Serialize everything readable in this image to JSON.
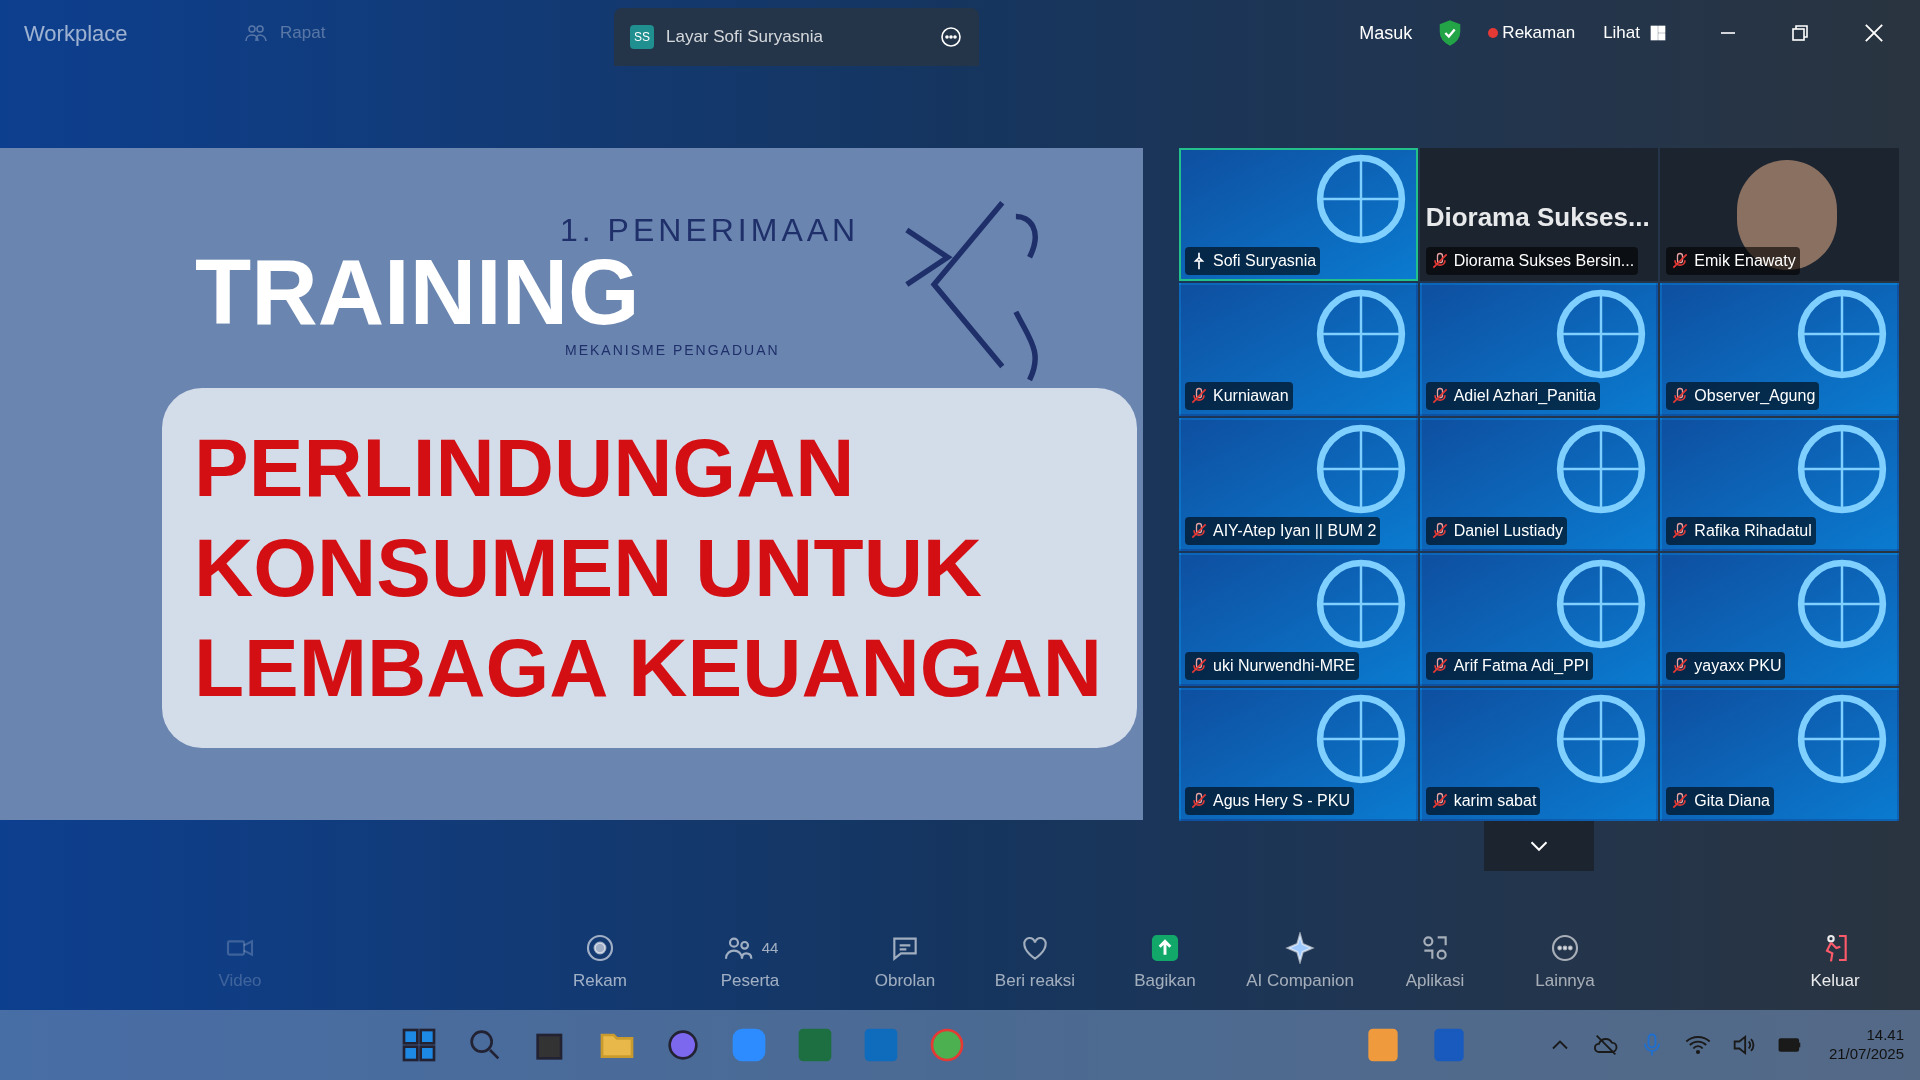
{
  "top_bar": {
    "app": "Workplace",
    "meeting_tab": "Rapat",
    "share_tab": {
      "initials": "SS",
      "label": "Layar Sofi Suryasnia"
    },
    "sign_in": "Masuk",
    "recording": "Rekaman",
    "view": "Lihat"
  },
  "shared_screen": {
    "heading": "1. PENERIMAAN",
    "subheading": "MEKANISME PENGADUAN"
  },
  "overlay": {
    "kicker": "TRAINING",
    "title_lines": [
      "PERLINDUNGAN",
      "KONSUMEN UNTUK",
      "LEMBAGA KEUANGAN"
    ]
  },
  "gallery": [
    {
      "name": "Sofi Suryasnia",
      "kind": "slide",
      "muted": false,
      "active": true
    },
    {
      "name": "Diorama Sukses Bersin...",
      "kind": "name-text",
      "banner": "Diorama  Sukses...",
      "muted": true,
      "active": false
    },
    {
      "name": "Emik Enawaty",
      "kind": "photo",
      "muted": true,
      "active": false
    },
    {
      "name": "Kurniawan",
      "kind": "slide",
      "muted": true,
      "active": false
    },
    {
      "name": "Adiel Azhari_Panitia",
      "kind": "slide",
      "muted": true,
      "active": false
    },
    {
      "name": "Observer_Agung",
      "kind": "slide",
      "muted": true,
      "active": false
    },
    {
      "name": "AIY-Atep Iyan || BUM 2",
      "kind": "slide",
      "muted": true,
      "active": false
    },
    {
      "name": "Daniel Lustiady",
      "kind": "slide",
      "muted": true,
      "active": false
    },
    {
      "name": "Rafika Rihadatul",
      "kind": "slide",
      "muted": true,
      "active": false
    },
    {
      "name": "uki Nurwendhi-MRE",
      "kind": "slide",
      "muted": true,
      "active": false
    },
    {
      "name": "Arif Fatma Adi_PPI",
      "kind": "slide",
      "muted": true,
      "active": false
    },
    {
      "name": "yayaxx PKU",
      "kind": "slide",
      "muted": true,
      "active": false
    },
    {
      "name": "Agus Hery S - PKU",
      "kind": "slide",
      "muted": true,
      "active": false
    },
    {
      "name": "karim sabat",
      "kind": "slide",
      "muted": true,
      "active": false
    },
    {
      "name": "Gita Diana",
      "kind": "slide",
      "muted": true,
      "active": false
    }
  ],
  "toolbar": [
    {
      "kind": "video",
      "label": "Video"
    },
    {
      "kind": "record",
      "label": "Rekam"
    },
    {
      "kind": "participants",
      "label": "Peserta",
      "count": "44"
    },
    {
      "kind": "chat",
      "label": "Obrolan"
    },
    {
      "kind": "react",
      "label": "Beri reaksi"
    },
    {
      "kind": "share",
      "label": "Bagikan"
    },
    {
      "kind": "ai",
      "label": "AI Companion"
    },
    {
      "kind": "apps",
      "label": "Aplikasi"
    },
    {
      "kind": "more",
      "label": "Lainnya"
    },
    {
      "kind": "leave",
      "label": "Keluar"
    }
  ],
  "taskbar": {
    "time": "14.41",
    "date": "21/07/2025"
  }
}
